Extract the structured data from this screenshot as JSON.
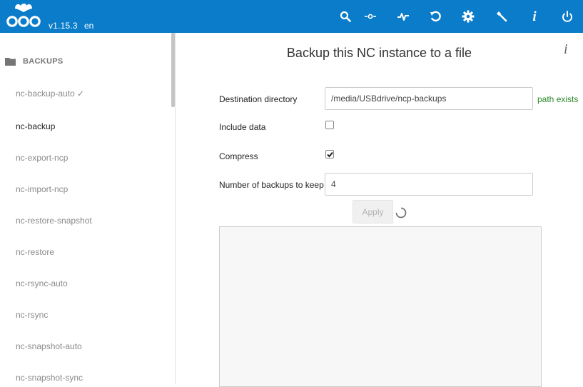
{
  "header": {
    "version": "v1.15.3",
    "language": "en",
    "bg_color": "#0a7cc9",
    "icons": [
      "search-icon",
      "network-icon",
      "activity-icon",
      "refresh-icon",
      "gear-icon",
      "wrench-icon",
      "info-icon",
      "power-icon"
    ]
  },
  "sidebar": {
    "section_title": "BACKUPS",
    "items": [
      {
        "label": "nc-backup-auto ✓",
        "active": false
      },
      {
        "label": "nc-backup",
        "active": true
      },
      {
        "label": "nc-export-ncp",
        "active": false
      },
      {
        "label": "nc-import-ncp",
        "active": false
      },
      {
        "label": "nc-restore-snapshot",
        "active": false
      },
      {
        "label": "nc-restore",
        "active": false
      },
      {
        "label": "nc-rsync-auto",
        "active": false
      },
      {
        "label": "nc-rsync",
        "active": false
      },
      {
        "label": "nc-snapshot-auto",
        "active": false
      },
      {
        "label": "nc-snapshot-sync",
        "active": false
      }
    ]
  },
  "main": {
    "title": "Backup this NC instance to a file",
    "info_glyph": "i",
    "fields": {
      "destination": {
        "label": "Destination directory",
        "value": "/media/USBdrive/ncp-backups",
        "status": "path exists"
      },
      "include_data": {
        "label": "Include data",
        "checked": false
      },
      "compress": {
        "label": "Compress",
        "checked": true
      },
      "keep": {
        "label": "Number of backups to keep",
        "value": "4"
      }
    },
    "apply_label": "Apply",
    "status_color": "#2b8a2b"
  }
}
